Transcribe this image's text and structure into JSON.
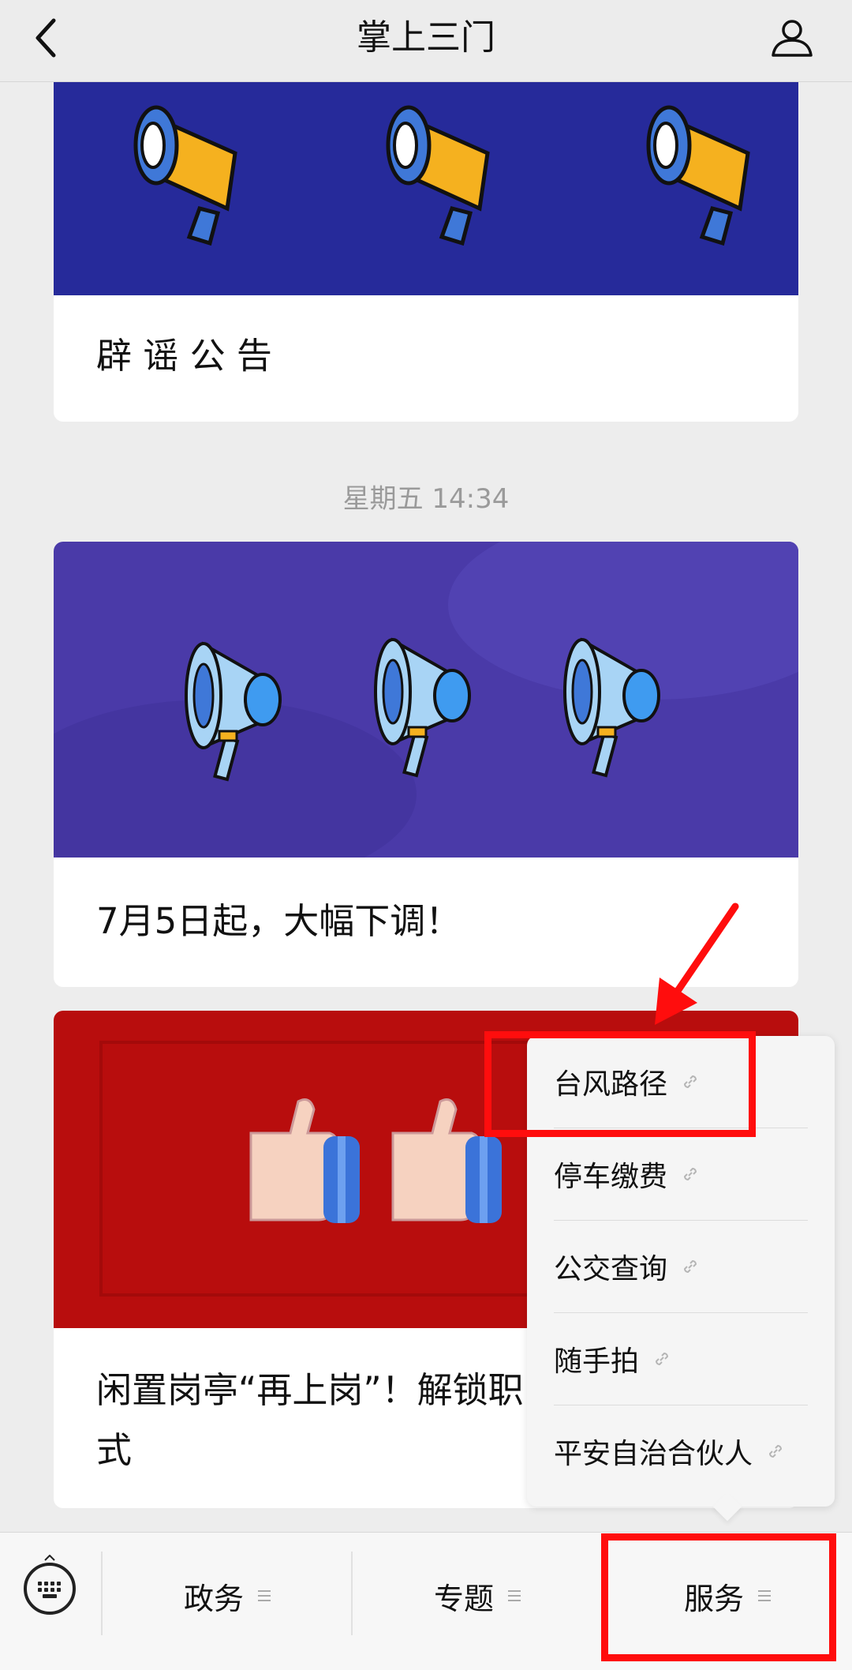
{
  "header": {
    "title": "掌上三门"
  },
  "feed": {
    "card1": {
      "caption": "辟 谣 公 告"
    },
    "time_label": "星期五 14:34",
    "card2": {
      "caption": "7月5日起，大幅下调！"
    },
    "card3": {
      "caption_line1": "闲置岗亭“再上岗”！解锁职",
      "caption_line2": "式"
    }
  },
  "popup_menu": {
    "items": [
      {
        "label": "台风路径",
        "icon": "link-icon"
      },
      {
        "label": "停车缴费",
        "icon": "link-icon"
      },
      {
        "label": "公交查询",
        "icon": "link-icon"
      },
      {
        "label": "随手拍",
        "icon": "link-icon"
      },
      {
        "label": "平安自治合伙人",
        "icon": "link-icon"
      }
    ]
  },
  "bottom_menu": {
    "tabs": [
      {
        "label": "政务"
      },
      {
        "label": "专题"
      },
      {
        "label": "服务"
      }
    ]
  },
  "colors": {
    "annotation_red": "#ff0d0d",
    "banner_navy": "#262a9a",
    "banner_purple": "#4a3aa8",
    "banner_red": "#b80d0d"
  }
}
